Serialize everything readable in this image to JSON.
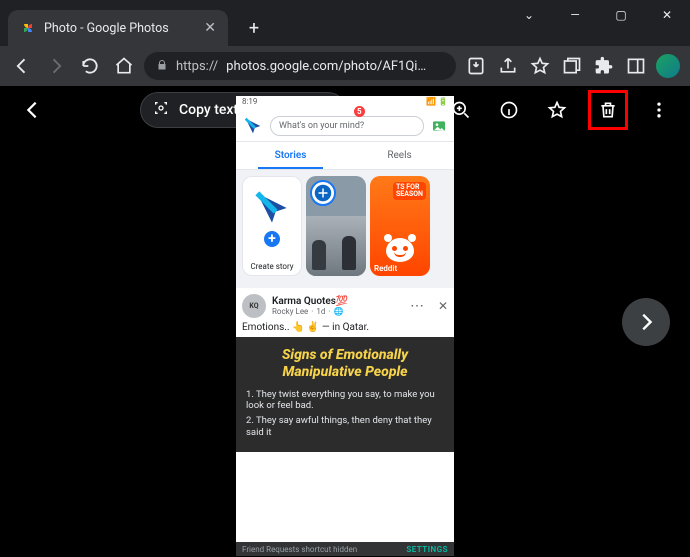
{
  "window": {
    "minimize": "—",
    "maximize": "▢",
    "close": "✕"
  },
  "browser": {
    "tab_title": "Photo - Google Photos",
    "url_host": "https://",
    "url_path": "photos.google.com/photo/AF1Qi…"
  },
  "viewer": {
    "copy_chip_label": "Copy text from image"
  },
  "phone": {
    "status_time": "8:19",
    "composer_placeholder": "What's on your mind?",
    "tabs": {
      "stories": "Stories",
      "reels": "Reels"
    },
    "create_story_label": "Create story",
    "reddit_tag_line1": "TS FOR",
    "reddit_tag_line2": "SEASON",
    "reddit_label": "Reddit",
    "post": {
      "name": "Karma Quotes💯",
      "author": "Rocky Lee",
      "age": "1d",
      "globe": "🌐",
      "dots": "⋯",
      "x": "✕",
      "body_pre": "Emotions.. ",
      "body_emoji": "👆 ✌️",
      "body_post": " — in Qatar."
    },
    "signs": {
      "title_line1": "Signs of Emotionally",
      "title_line2": "Manipulative People",
      "pt1": "1. They twist everything you say, to make you look or feel bad.",
      "pt2": "2. They say awful things, then deny that they said it"
    },
    "footer": {
      "text": "Friend Requests shortcut hidden",
      "settings": "SETTINGS"
    },
    "notif": "5"
  }
}
